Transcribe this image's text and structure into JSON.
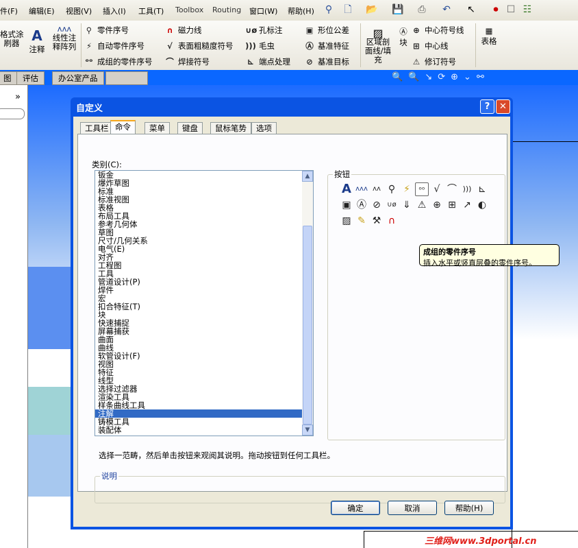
{
  "menubar": {
    "items": [
      "件(F)",
      "编辑(E)",
      "视图(V)",
      "插入(I)",
      "工具(T)",
      "Toolbox",
      "Routing",
      "窗口(W)",
      "帮助(H)"
    ]
  },
  "cmdmgr": {
    "big": [
      "格式涂\n刷器",
      "注释",
      "线性注\n释阵列"
    ],
    "col1": [
      "零件序号",
      "自动零件序号",
      "成组的零件序号"
    ],
    "col2": [
      "磁力线",
      "表面粗糙度符号",
      "焊接符号"
    ],
    "col3": [
      "孔标注",
      "毛虫",
      "端点处理"
    ],
    "col4": [
      "形位公差",
      "基准特征",
      "基准目标"
    ],
    "area": "区域剖\n面线/填\n充",
    "block": "块",
    "col5": [
      "中心符号线",
      "中心线",
      "修订符号"
    ],
    "table": "表格"
  },
  "cm_tabs": [
    "图",
    "评估",
    "办公室产品"
  ],
  "dialog": {
    "title": "自定义",
    "help_btn": "?",
    "close_btn": "✕",
    "tabs": [
      "工具栏",
      "命令",
      "菜单",
      "键盘",
      "鼠标笔势",
      "选项"
    ],
    "category_label": "类别(C):",
    "categories": [
      "钣金",
      "爆炸草图",
      "标准",
      "标准视图",
      "表格",
      "布局工具",
      "参考几何体",
      "草图",
      "尺寸/几何关系",
      "电气(E)",
      "对齐",
      "工程图",
      "工具",
      "管道设计(P)",
      "焊件",
      "宏",
      "扣合特征(T)",
      "块",
      "快速捕捉",
      "屏幕捕获",
      "曲面",
      "曲线",
      "软管设计(F)",
      "视图",
      "特征",
      "线型",
      "选择过滤器",
      "渲染工具",
      "样条曲线工具",
      "注解",
      "铸模工具",
      "装配体"
    ],
    "selected_category": "注解",
    "buttons_label": "按钮",
    "tooltip_title": "成组的零件序号",
    "tooltip_text": "插入水平或竖直层叠的零件序号。",
    "hint": "选择一范畴，然后单击按钮来观阅其说明。拖动按钮到任何工具栏。",
    "description_label": "说明",
    "ok": "确定",
    "cancel": "取消",
    "help": "帮助(H)"
  },
  "watermark": "三维网www.3dportal.cn"
}
